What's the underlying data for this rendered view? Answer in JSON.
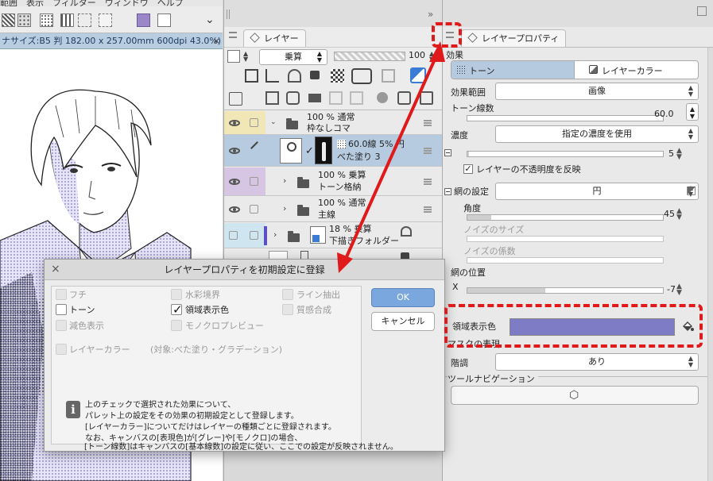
{
  "menu": {
    "partial_text": "範囲　表示　フィルター　ウィンドウ　ヘルプ"
  },
  "canvas": {
    "tab_label": "ナサイズ:B5 判 182.00 x 257.00mm 600dpi 43.0%)",
    "tab_close": "×"
  },
  "layer_panel": {
    "tab_label": "レイヤー",
    "blend_mode": "乗算",
    "opacity": "100",
    "layers": [
      {
        "line1": "100 % 通常",
        "line2": "枠なしコマ"
      },
      {
        "line1": "60.0線 5% 円",
        "line2": "べた塗り 3"
      },
      {
        "line1": "100 % 乗算",
        "line2": "トーン格納"
      },
      {
        "line1": "100 % 通常",
        "line2": "主線"
      },
      {
        "line1": "18 % 乗算",
        "line2": "下描きフォルダー"
      }
    ]
  },
  "prop_panel": {
    "tab_label": "レイヤープロパティ",
    "section_effect": "効果",
    "btn_tone": "トーン",
    "btn_layer_color": "レイヤーカラー",
    "effect_range_label": "効果範囲",
    "effect_range_value": "画像",
    "tone_lines_label": "トーン線数",
    "tone_lines_value": "60.0",
    "density_label": "濃度",
    "density_value": "指定の濃度を使用",
    "density_num": "5",
    "reflect_opacity": "レイヤーの不透明度を反映",
    "dot_settings_label": "網の設定",
    "dot_settings_value": "円",
    "angle_label": "角度",
    "angle_value": "45",
    "noise_size_label": "ノイズのサイズ",
    "noise_factor_label": "ノイズの係数",
    "dot_position_label": "網の位置",
    "x_label": "X",
    "x_value": "-7",
    "area_color_label": "領域表示色",
    "mask_label": "マスクの表現",
    "tone_level_label": "階調",
    "tone_level_value": "あり",
    "tool_nav_label": "ツールナビゲーション"
  },
  "dialog": {
    "title": "レイヤープロパティを初期設定に登録",
    "close": "×",
    "ok": "OK",
    "cancel": "キャンセル",
    "options": {
      "fuchi": "フチ",
      "tone": "トーン",
      "reduced_color": "減色表示",
      "watercolor_edge": "水彩境界",
      "area_color": "領域表示色",
      "mono_preview": "モノクロプレビュー",
      "line_extract": "ライン抽出",
      "texture": "質感合成",
      "layer_color": "レイヤーカラー",
      "layer_color_note": "(対象:べた塗り・グラデーション)"
    },
    "info_icon": "i",
    "info_lines": [
      "上のチェックで選択された効果について、",
      "パレット上の設定をその効果の初期設定として登録します。",
      "[レイヤーカラー]についてだけはレイヤーの種類ごとに登録されます。",
      "なお、キャンバスの[表現色]が[グレー]や[モノクロ]の場合、",
      "[トーン線数]はキャンバスの[基本線数]の設定に従い、ここでの設定が反映されません。"
    ]
  },
  "colors": {
    "area_display_color": "#7e7cc4",
    "selected_row": "#b6cbe0",
    "tone_button_active": "#b5c9df",
    "annotation_red": "#e01a1a"
  }
}
